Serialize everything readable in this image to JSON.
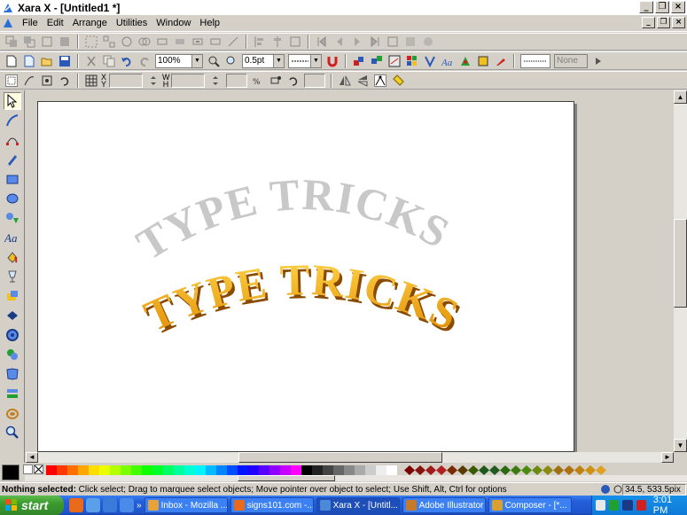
{
  "window": {
    "title": "Xara X - [Untitled1 *]",
    "controls": {
      "minimize": "_",
      "maximize": "❐",
      "close": "×"
    }
  },
  "menu": {
    "items": [
      "File",
      "Edit",
      "Arrange",
      "Utilities",
      "Window",
      "Help"
    ]
  },
  "toolbar": {
    "zoom_value": "100%",
    "line_width_value": "0.5pt",
    "none_value": "None",
    "x_label": "X",
    "y_label": "Y",
    "w_label": "W",
    "h_label": "H"
  },
  "canvas": {
    "text_top": "TYPE TRICKS",
    "text_bottom": "TYPE TRICKS",
    "colors": {
      "top_fill": "#c8c8c8",
      "bottom_fill_light": "#ffd54a",
      "bottom_fill_dark": "#e08a00",
      "bottom_shadow": "#8a4a00"
    }
  },
  "status": {
    "bold_part": "Nothing selected:",
    "rest": " Click select; Drag to marquee select objects; Move pointer over object to select; Use Shift, Alt, Ctrl for options",
    "coords": "34.5, 533.5pix"
  },
  "taskbar": {
    "start_label": "start",
    "more_label": "»",
    "tasks": [
      {
        "label": "Inbox - Mozilla ...",
        "color": "#e8a23a"
      },
      {
        "label": "signs101.com -...",
        "color": "#e86a1a"
      },
      {
        "label": "Xara X - [Untitl...",
        "color": "#4a8ad8"
      },
      {
        "label": "Adobe Illustrator",
        "color": "#c77a2a"
      },
      {
        "label": "Composer - [*...",
        "color": "#d9a030"
      }
    ],
    "clock": "3:01 PM"
  },
  "icons": {
    "app": "xara-app-icon",
    "tools": [
      "selector-icon",
      "freehand-icon",
      "shape-editor-icon",
      "pen-icon",
      "rectangle-icon",
      "ellipse-icon",
      "quickshape-icon",
      "text-icon",
      "fill-icon",
      "transparency-icon",
      "mould-icon",
      "extrude-icon",
      "bevel-icon",
      "contour-icon",
      "blend-icon",
      "envelope-icon",
      "shadow-icon",
      "live-effects-icon",
      "zoom-icon"
    ]
  }
}
